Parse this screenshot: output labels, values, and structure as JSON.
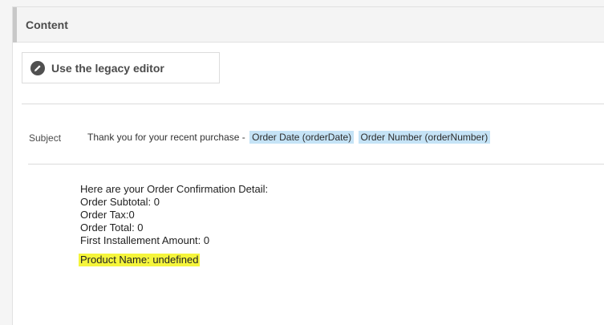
{
  "section": {
    "title": "Content"
  },
  "legacy_button": {
    "label": "Use the legacy editor",
    "icon": "pencil-icon"
  },
  "subject": {
    "label": "Subject",
    "prefix": "Thank you for your recent purchase -",
    "tokens": [
      "Order Date (orderDate)",
      "Order Number (orderNumber)"
    ]
  },
  "body": {
    "lines": [
      "Here are your Order Confirmation Detail:",
      "Order Subtotal: 0",
      "Order Tax:0",
      "Order Total: 0",
      "First Installement Amount: 0"
    ],
    "highlighted": "Product Name: undefined"
  },
  "colors": {
    "token_bg": "#c5e3f6",
    "highlight": "#f5f53c"
  }
}
